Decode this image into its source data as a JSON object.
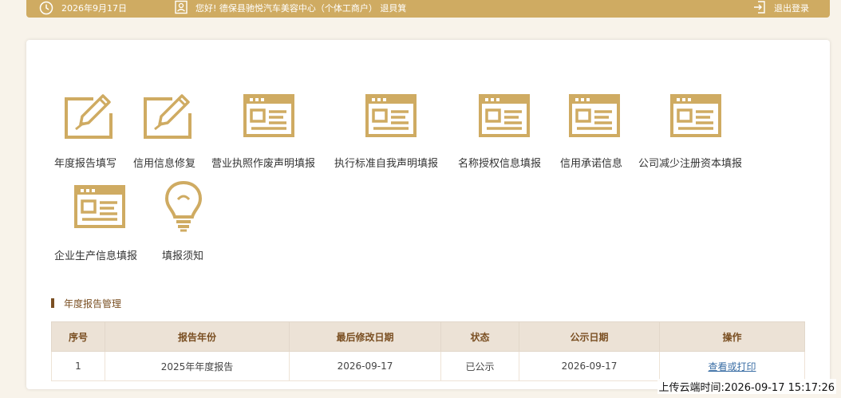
{
  "header": {
    "date": "2026年9月17日",
    "greeting": "您好! 德保县驰悦汽车美容中心（个体工商户） 退貝箕",
    "logout": "退出登录"
  },
  "tiles": [
    {
      "label": "年度报告填写",
      "icon": "pencil-icon"
    },
    {
      "label": "信用信息修复",
      "icon": "pencil-icon"
    },
    {
      "label": "营业执照作废声明填报",
      "icon": "form-window-icon"
    },
    {
      "label": "执行标准自我声明填报",
      "icon": "form-window-icon"
    },
    {
      "label": "名称授权信息填报",
      "icon": "form-window-icon"
    },
    {
      "label": "信用承诺信息",
      "icon": "form-window-icon"
    },
    {
      "label": "公司减少注册资本填报",
      "icon": "form-window-icon"
    },
    {
      "label": "企业生产信息填报",
      "icon": "form-window-icon"
    },
    {
      "label": "填报须知",
      "icon": "lightbulb-icon"
    }
  ],
  "section": {
    "title": "年度报告管理"
  },
  "table": {
    "headers": [
      "序号",
      "报告年份",
      "最后修改日期",
      "状态",
      "公示日期",
      "操作"
    ],
    "rows": [
      {
        "index": "1",
        "year": "2025年年度报告",
        "modified": "2026-09-17",
        "status": "已公示",
        "published": "2026-09-17",
        "action": "查看或打印"
      }
    ]
  },
  "footer": {
    "upload_time": "上传云端时间:2026-09-17 15:17:26"
  },
  "colors": {
    "accent": "#cfab62",
    "brown": "#7a4f22",
    "link": "#3a6ea5"
  }
}
